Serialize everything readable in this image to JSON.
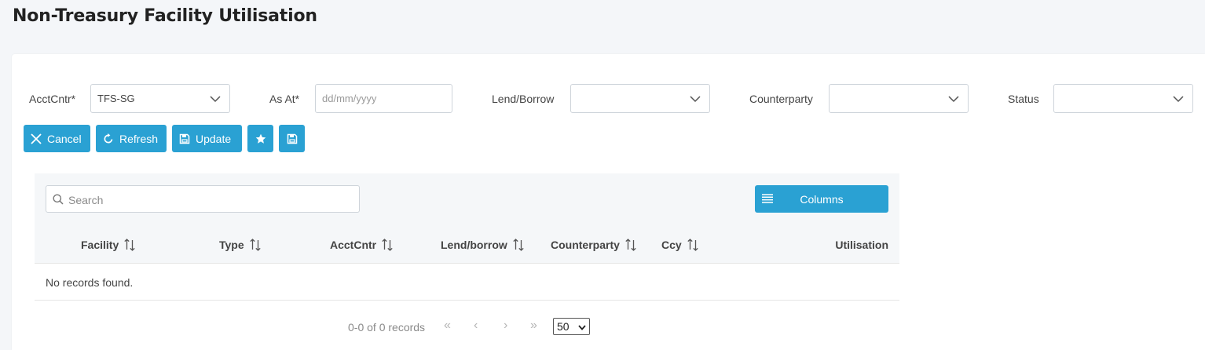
{
  "page": {
    "title": "Non-Treasury Facility Utilisation"
  },
  "filters": {
    "acctcntr": {
      "label": "AcctCntr*",
      "value": "TFS-SG"
    },
    "as_at": {
      "label": "As At*",
      "placeholder": "dd/mm/yyyy",
      "value": ""
    },
    "lend_borrow": {
      "label": "Lend/Borrow",
      "value": ""
    },
    "counterparty": {
      "label": "Counterparty",
      "value": ""
    },
    "status": {
      "label": "Status",
      "value": ""
    }
  },
  "toolbar": {
    "cancel_label": "Cancel",
    "refresh_label": "Refresh",
    "update_label": "Update",
    "favorite_icon": "star-icon",
    "save_icon": "floppy-disk-icon"
  },
  "grid": {
    "search_placeholder": "Search",
    "columns_label": "Columns",
    "columns": [
      "Facility",
      "Type",
      "AcctCntr",
      "Lend/borrow",
      "Counterparty",
      "Ccy",
      "Utilisation"
    ],
    "empty_message": "No records found.",
    "rows": []
  },
  "pagination": {
    "summary": "0-0 of 0 records",
    "page_size": "50"
  },
  "colors": {
    "accent": "#2aa1d3",
    "background": "#f4f6f9",
    "grid_header": "#f5f7f9"
  }
}
